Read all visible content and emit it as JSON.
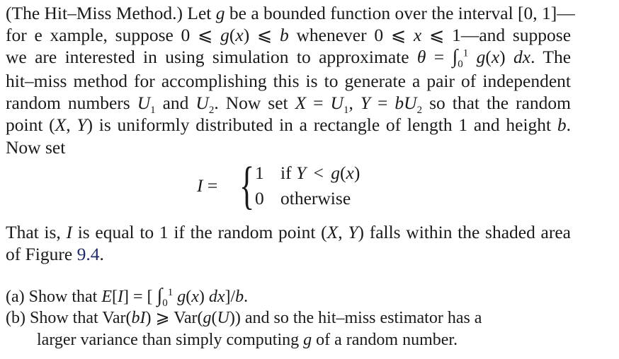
{
  "paragraph1": {
    "lines": [
      {
        "parts": [
          "(The Hit–Miss Method.) Let ",
          "g",
          " be a bounded function over the interval [0, 1]—"
        ]
      },
      {
        "parts": [
          "for e xample, suppose 0 ",
          "⩽",
          " ",
          "g",
          "(",
          "x",
          ") ",
          "⩽",
          " ",
          "b",
          " whenever 0 ",
          "⩽",
          " ",
          "x",
          " ",
          "⩽",
          " 1—and suppose"
        ]
      },
      {
        "parts": [
          "we are interested in using simulation to approximate ",
          "θ",
          " = ",
          "∫",
          "0",
          "1",
          " ",
          "g",
          "(",
          "x",
          ") ",
          "dx",
          ". The"
        ]
      },
      {
        "text": "hit–miss method for accomplishing this is to generate a pair of independent"
      },
      {
        "parts": [
          "random numbers ",
          "U",
          "1",
          " and ",
          "U",
          "2",
          ". Now set ",
          "X",
          " = ",
          "U",
          "1",
          ", ",
          "Y",
          " = ",
          "b",
          "U",
          "2",
          " so that the random"
        ]
      },
      {
        "parts": [
          "point (",
          "X",
          ", ",
          "Y",
          ") is uniformly distributed in a rectangle of length 1 and height ",
          "b",
          "."
        ]
      },
      {
        "text": "Now set"
      }
    ]
  },
  "equation": {
    "lhs": "I",
    "equals": "=",
    "cases": [
      {
        "value": "1",
        "condition_prefix": "if ",
        "condition_var": "Y",
        "condition_rel": " < ",
        "condition_rhs": "g",
        "condition_arg": "x"
      },
      {
        "value": "0",
        "condition_text": "otherwise"
      }
    ]
  },
  "paragraph2": {
    "line1_a": "That is, ",
    "line1_var": "I",
    "line1_b": " is equal to 1 if the random point (",
    "line1_x": "X",
    "line1_c": ", ",
    "line1_y": "Y",
    "line1_d": ") falls within the shaded area",
    "line2_a": "of Figure ",
    "line2_link": "9.4",
    "line2_b": "."
  },
  "exercises": {
    "a": {
      "label": "(a)",
      "text_a": "Show that ",
      "E": "E",
      "bracket_open": "[",
      "I": "I",
      "bracket_close": "] = [ ",
      "integral": "∫",
      "lower": "0",
      "upper": "1",
      "g": "g",
      "x": "x",
      "dx": "dx",
      "tail": "]/",
      "b": "b",
      "end": "."
    },
    "b": {
      "label": "(b)",
      "line1_a": "Show that Var(",
      "b": "b",
      "I": "I",
      "line1_b": ") ⩾ Var(",
      "g": "g",
      "line1_c": "(",
      "U": "U",
      "line1_d": ")) and so the hit–miss estimator has a",
      "line2_a": "larger variance than simply computing ",
      "line2_g": "g",
      "line2_b": " of a random number."
    }
  }
}
